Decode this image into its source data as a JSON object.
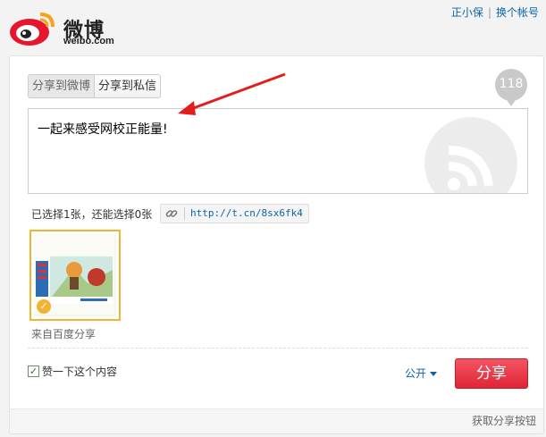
{
  "brand": {
    "name": "微博",
    "domain": "weibo.com",
    "accent": "#e6162d"
  },
  "header": {
    "user_link": "正小保",
    "switch_account": "换个帐号"
  },
  "tabs": [
    {
      "label": "分享到微博"
    },
    {
      "label": "分享到私信"
    }
  ],
  "counter": "118",
  "post": {
    "text": "一起来感受网校正能量!"
  },
  "selection": {
    "info": "已选择1张，还能选择0张",
    "short_url": "http://t.cn/8sx6fk4"
  },
  "source": "来自百度分享",
  "like": {
    "label": "赞一下这个内容",
    "checked": true
  },
  "visibility": "公开",
  "share_button": "分享",
  "footer": "获取分享按钮",
  "colors": {
    "share_button": "#e02436",
    "link": "#0a63a6",
    "thumb_border": "#f1b42f"
  }
}
